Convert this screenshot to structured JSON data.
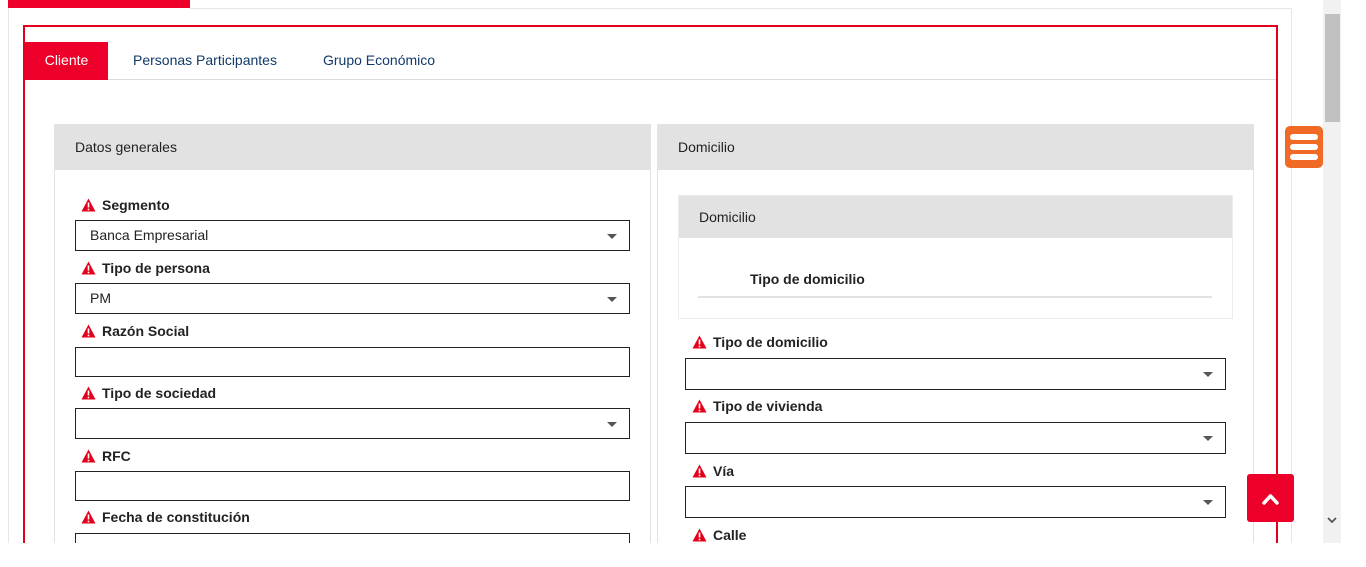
{
  "tabs": [
    {
      "label": "Cliente",
      "active": true
    },
    {
      "label": "Personas Participantes",
      "active": false
    },
    {
      "label": "Grupo Económico",
      "active": false
    }
  ],
  "datos_generales": {
    "title": "Datos generales",
    "fields": [
      {
        "label": "Segmento",
        "value": "Banca Empresarial",
        "type": "select"
      },
      {
        "label": "Tipo de persona",
        "value": "PM",
        "type": "select"
      },
      {
        "label": "Razón Social",
        "value": "",
        "type": "text"
      },
      {
        "label": "Tipo de sociedad",
        "value": "",
        "type": "select"
      },
      {
        "label": "RFC",
        "value": "",
        "type": "text"
      },
      {
        "label": "Fecha de constitución",
        "value": "",
        "type": "text"
      }
    ]
  },
  "domicilio": {
    "title": "Domicilio",
    "subpanel": {
      "title": "Domicilio",
      "heading": "Tipo de domicilio"
    },
    "fields": [
      {
        "label": "Tipo de domicilio",
        "value": "",
        "type": "select"
      },
      {
        "label": "Tipo de vivienda",
        "value": "",
        "type": "select"
      },
      {
        "label": "Vía",
        "value": "",
        "type": "select"
      },
      {
        "label": "Calle",
        "value": "",
        "type": "text"
      }
    ]
  },
  "icons": {
    "required": "warning-icon",
    "menu": "hamburger-menu-icon",
    "scroll_top": "chevron-up-icon",
    "scroll_down": "chevron-down-icon"
  },
  "colors": {
    "accent": "#ec0029",
    "menu_orange": "#f06a26",
    "link": "#123a6b",
    "panel_header": "#e2e2e2"
  }
}
